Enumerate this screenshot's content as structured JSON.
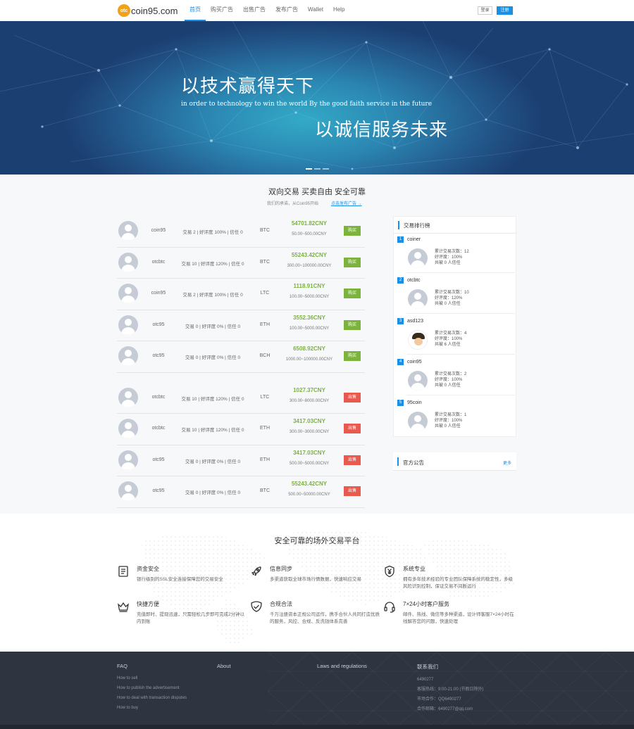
{
  "nav": {
    "logo_badge": "otc",
    "logo_text": "coin95.com",
    "menu": [
      {
        "label": "首页",
        "active": true
      },
      {
        "label": "购买广告"
      },
      {
        "label": "出售广告"
      },
      {
        "label": "发布广告"
      },
      {
        "label": "Wallet"
      },
      {
        "label": "Help"
      }
    ],
    "login": "登录",
    "register": "注册"
  },
  "banner": {
    "title1": "以技术赢得天下",
    "subtitle": "in order to technology to win the world By the good faith service in the future",
    "title2": "以诚信服务未来"
  },
  "trade": {
    "title": "双向交易 买卖自由 安全可靠",
    "subtitle": "我们的承诺，从Coin95开始",
    "link": "点击发布广告 →",
    "buy_rows": [
      {
        "name": "coin95",
        "info": "交易 2 | 好评度 100% | 信任 0",
        "coin": "BTC",
        "price": "54701.82CNY",
        "range": "50.00~500.00CNY",
        "action": "购买"
      },
      {
        "name": "otcbtc",
        "info": "交易 10 | 好评度 120% | 信任 0",
        "coin": "BTC",
        "price": "55243.42CNY",
        "range": "300.00~100000.00CNY",
        "action": "购买"
      },
      {
        "name": "coin95",
        "info": "交易 2 | 好评度 100% | 信任 0",
        "coin": "LTC",
        "price": "1118.91CNY",
        "range": "100.00~5000.00CNY",
        "action": "购买"
      },
      {
        "name": "otc95",
        "info": "交易 0 | 好评度 0% | 信任 0",
        "coin": "ETH",
        "price": "3552.36CNY",
        "range": "100.00~5000.00CNY",
        "action": "购买"
      },
      {
        "name": "otc95",
        "info": "交易 0 | 好评度 0% | 信任 0",
        "coin": "BCH",
        "price": "6508.92CNY",
        "range": "1000.00~100000.00CNY",
        "action": "购买"
      }
    ],
    "sell_rows": [
      {
        "name": "otcbtc",
        "info": "交易 10 | 好评度 120% | 信任 0",
        "coin": "LTC",
        "price": "1027.37CNY",
        "range": "300.00~8000.00CNY",
        "action": "出售"
      },
      {
        "name": "otcbtc",
        "info": "交易 10 | 好评度 120% | 信任 0",
        "coin": "ETH",
        "price": "3417.03CNY",
        "range": "300.00~3000.00CNY",
        "action": "出售"
      },
      {
        "name": "otc95",
        "info": "交易 0 | 好评度 0% | 信任 0",
        "coin": "ETH",
        "price": "3417.03CNY",
        "range": "500.00~5000.00CNY",
        "action": "出售"
      },
      {
        "name": "otc95",
        "info": "交易 0 | 好评度 0% | 信任 0",
        "coin": "BTC",
        "price": "55243.42CNY",
        "range": "500.00~50000.00CNY",
        "action": "出售"
      }
    ]
  },
  "ranking": {
    "title": "交易排行榜",
    "items": [
      {
        "rank": "1",
        "name": "coiner",
        "trades": "累计交易次数：12",
        "rating": "好评度：100%",
        "trust": "共被 0 人信任"
      },
      {
        "rank": "2",
        "name": "otcbtc",
        "trades": "累计交易次数：10",
        "rating": "好评度：120%",
        "trust": "共被 0 人信任"
      },
      {
        "rank": "3",
        "name": "asd123",
        "trades": "累计交易次数：4",
        "rating": "好评度：100%",
        "trust": "共被 6 人信任"
      },
      {
        "rank": "4",
        "name": "coin95",
        "trades": "累计交易次数：2",
        "rating": "好评度：100%",
        "trust": "共被 0 人信任"
      },
      {
        "rank": "5",
        "name": "95coin",
        "trades": "累计交易次数：1",
        "rating": "好评度：100%",
        "trust": "共被 0 人信任"
      }
    ]
  },
  "notice": {
    "title": "官方公告",
    "more": "更多"
  },
  "features": {
    "title": "安全可靠的场外交易平台",
    "items": [
      {
        "icon": "document-icon",
        "title": "资金安全",
        "desc": "银行级别的SSL安全连接保障您的交易安全"
      },
      {
        "icon": "rocket-icon",
        "title": "信息同步",
        "desc": "多渠道获取全球市场行情数据，快速响应交易"
      },
      {
        "icon": "yuan-shield-icon",
        "title": "系统专业",
        "desc": "拥有多年技术经验的专业团队保障系统的稳定性，多级风险识别控制，保证交易不间断运行"
      },
      {
        "icon": "crown-icon",
        "title": "快捷方便",
        "desc": "充值即时、提现迅速，只需轻松几步即可完成2分钟以内到账"
      },
      {
        "icon": "shield-check-icon",
        "title": "合规合法",
        "desc": "千万注册资本正规公司运作，携手合伙人共同打造优质的服务，风控、合规、反洗钱体系完善"
      },
      {
        "icon": "headset-icon",
        "title": "7×24小时客户服务",
        "desc": "邮件、热线、微信等多种渠道，设计师客服7×24小时在线解答您的问题，快速处理"
      }
    ]
  },
  "footer": {
    "faq": {
      "title": "FAQ",
      "links": [
        "How to sell",
        "How to publish the advertisement",
        "How to deal with transaction disputes",
        "How to buy"
      ]
    },
    "about": {
      "title": "About"
    },
    "laws": {
      "title": "Laws and regulations"
    },
    "contact": {
      "title": "联系我们",
      "lines": [
        "6490277",
        "客服热线：9:00-21:00 (节假日除外)",
        "市场合作：QQ6490277",
        "合作邮箱：6490277@qq.com"
      ]
    }
  }
}
